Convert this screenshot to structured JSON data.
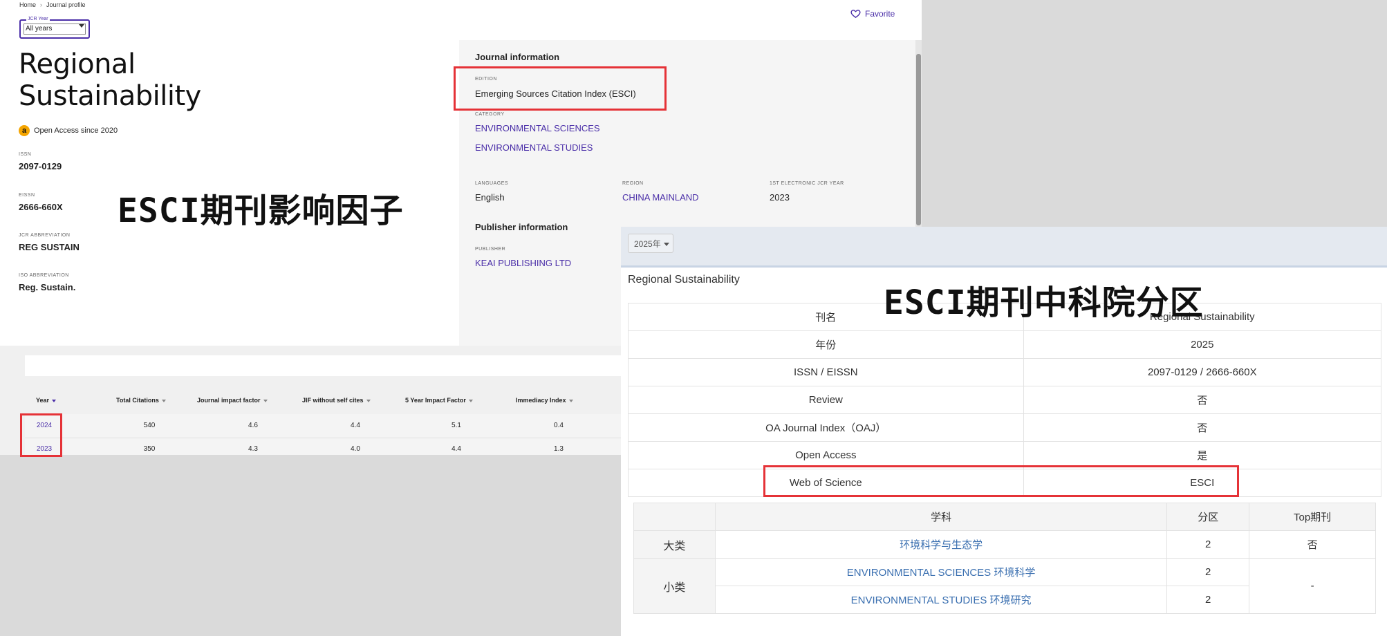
{
  "breadcrumb": {
    "home": "Home",
    "current": "Journal profile"
  },
  "favorite_label": "Favorite",
  "jcr_year": {
    "label": "JCR Year",
    "value": "All years"
  },
  "journal": {
    "title_line1": "Regional",
    "title_line2": "Sustainability",
    "open_access": "Open Access since 2020",
    "fields": [
      {
        "label": "ISSN",
        "value": "2097-0129"
      },
      {
        "label": "EISSN",
        "value": "2666-660X"
      },
      {
        "label": "JCR ABBREVIATION",
        "value": "REG SUSTAIN"
      },
      {
        "label": "ISO ABBREVIATION",
        "value": "Reg. Sustain."
      }
    ]
  },
  "overlay_left": "ESCI期刊影响因子",
  "overlay_right": "ESCI期刊中科院分区",
  "journal_info": {
    "heading": "Journal information",
    "edition_label": "EDITION",
    "edition_value": "Emerging Sources Citation Index (ESCI)",
    "category_label": "CATEGORY",
    "categories": [
      "ENVIRONMENTAL SCIENCES",
      "ENVIRONMENTAL STUDIES"
    ],
    "languages_label": "LANGUAGES",
    "languages_value": "English",
    "region_label": "REGION",
    "region_value": "CHINA MAINLAND",
    "first_year_label": "1ST ELECTRONIC JCR YEAR",
    "first_year_value": "2023",
    "publisher_heading": "Publisher information",
    "publisher_label": "PUBLISHER",
    "publisher_value": "KEAI PUBLISHING LTD"
  },
  "metrics_table": {
    "headers": [
      "Year",
      "Total Citations",
      "Journal impact factor",
      "JIF without self cites",
      "5 Year Impact Factor",
      "Immediacy Index"
    ],
    "rows": [
      [
        "2024",
        "540",
        "4.6",
        "4.4",
        "5.1",
        "0.4"
      ],
      [
        "2023",
        "350",
        "4.3",
        "4.0",
        "4.4",
        "1.3"
      ]
    ]
  },
  "cas": {
    "year_select": "2025年",
    "journal_name": "Regional Sustainability",
    "info_rows": [
      [
        "刊名",
        "Regional Sustainability"
      ],
      [
        "年份",
        "2025"
      ],
      [
        "ISSN / EISSN",
        "2097-0129 / 2666-660X"
      ],
      [
        "Review",
        "否"
      ],
      [
        "OA Journal Index（OAJ）",
        "否"
      ],
      [
        "Open Access",
        "是"
      ],
      [
        "Web of Science",
        "ESCI"
      ]
    ],
    "sub_headers": [
      "学科",
      "分区",
      "Top期刊"
    ],
    "major_label": "大类",
    "major_subject": "环境科学与生态学",
    "major_zone": "2",
    "major_top": "否",
    "minor_label": "小类",
    "minor_subjects": [
      {
        "name": "ENVIRONMENTAL SCIENCES 环境科学",
        "zone": "2"
      },
      {
        "name": "ENVIRONMENTAL STUDIES 环境研究",
        "zone": "2"
      }
    ],
    "minor_top": "-"
  },
  "colors": {
    "accent": "#4a2ea8",
    "highlight": "#e53237",
    "link_blue": "#3a6fb0"
  }
}
